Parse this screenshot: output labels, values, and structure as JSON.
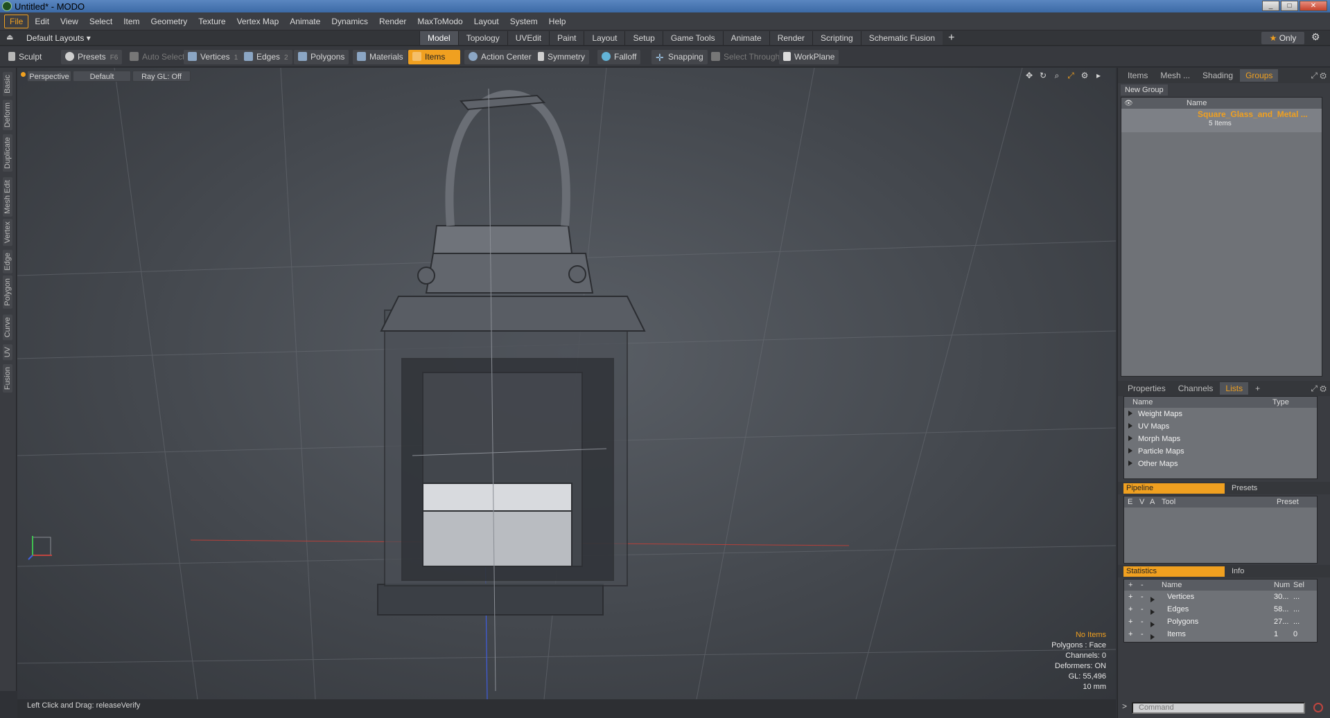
{
  "window": {
    "title": "Untitled* - MODO",
    "min": "_",
    "max": "□",
    "close": "✕"
  },
  "menu": [
    "File",
    "Edit",
    "View",
    "Select",
    "Item",
    "Geometry",
    "Texture",
    "Vertex Map",
    "Animate",
    "Dynamics",
    "Render",
    "MaxToModo",
    "Layout",
    "System",
    "Help"
  ],
  "layoutbar": {
    "layouts_label": "Default Layouts ▾",
    "tabs": [
      "Model",
      "Topology",
      "UVEdit",
      "Paint",
      "Layout",
      "Setup",
      "Game Tools",
      "Animate",
      "Render",
      "Scripting",
      "Schematic Fusion"
    ],
    "active_tab": "Model",
    "add": "+",
    "only_label": "Only",
    "star": "★"
  },
  "toolbar": {
    "sculpt": "Sculpt",
    "presets": "Presets",
    "presets_key": "F6",
    "auto_select": "Auto Select",
    "vertices": "Vertices",
    "vertices_key": "1",
    "edges": "Edges",
    "edges_key": "2",
    "polygons": "Polygons",
    "materials": "Materials",
    "items": "Items",
    "action_center": "Action Center",
    "symmetry": "Symmetry",
    "falloff": "Falloff",
    "snapping": "Snapping",
    "select_through": "Select Through",
    "workplane": "WorkPlane"
  },
  "left_tabs": [
    "Basic",
    "Deform",
    "Duplicate",
    "Mesh Edit",
    "Vertex",
    "Edge",
    "Polygon",
    "Curve",
    "UV",
    "Fusion"
  ],
  "viewport": {
    "view": "Perspective",
    "shading": "Default",
    "raygl": "Ray GL: Off",
    "stats": {
      "no_items": "No Items",
      "polygons": "Polygons : Face",
      "channels": "Channels: 0",
      "deformers": "Deformers: ON",
      "gl": "GL: 55,496",
      "unit": "10 mm"
    }
  },
  "status": "Left Click and Drag:   releaseVerify",
  "groups_panel": {
    "tabs": [
      "Items",
      "Mesh ...",
      "Shading",
      "Groups"
    ],
    "active": "Groups",
    "new_group": "New Group",
    "col_name": "Name",
    "group_name": "Square_Glass_and_Metal ...",
    "group_count": "5 Items"
  },
  "lists_panel": {
    "tabs": [
      "Properties",
      "Channels",
      "Lists"
    ],
    "active": "Lists",
    "add": "+",
    "col_name": "Name",
    "col_type": "Type",
    "items": [
      "Weight Maps",
      "UV Maps",
      "Morph Maps",
      "Particle Maps",
      "Other Maps"
    ]
  },
  "pipeline": {
    "tab_a": "Pipeline",
    "tab_b": "Presets",
    "cols": [
      "E",
      "V",
      "A",
      "Tool",
      "Preset"
    ]
  },
  "statistics": {
    "tab_a": "Statistics",
    "tab_b": "Info",
    "cols": {
      "plus": "+",
      "minus": "-",
      "name": "Name",
      "num": "Num",
      "sel": "Sel"
    },
    "rows": [
      {
        "name": "Vertices",
        "num": "30...",
        "sel": "..."
      },
      {
        "name": "Edges",
        "num": "58...",
        "sel": "..."
      },
      {
        "name": "Polygons",
        "num": "27...",
        "sel": "..."
      },
      {
        "name": "Items",
        "num": "1",
        "sel": "0"
      }
    ]
  },
  "command": {
    "placeholder": "Command",
    "prompt": ">"
  }
}
